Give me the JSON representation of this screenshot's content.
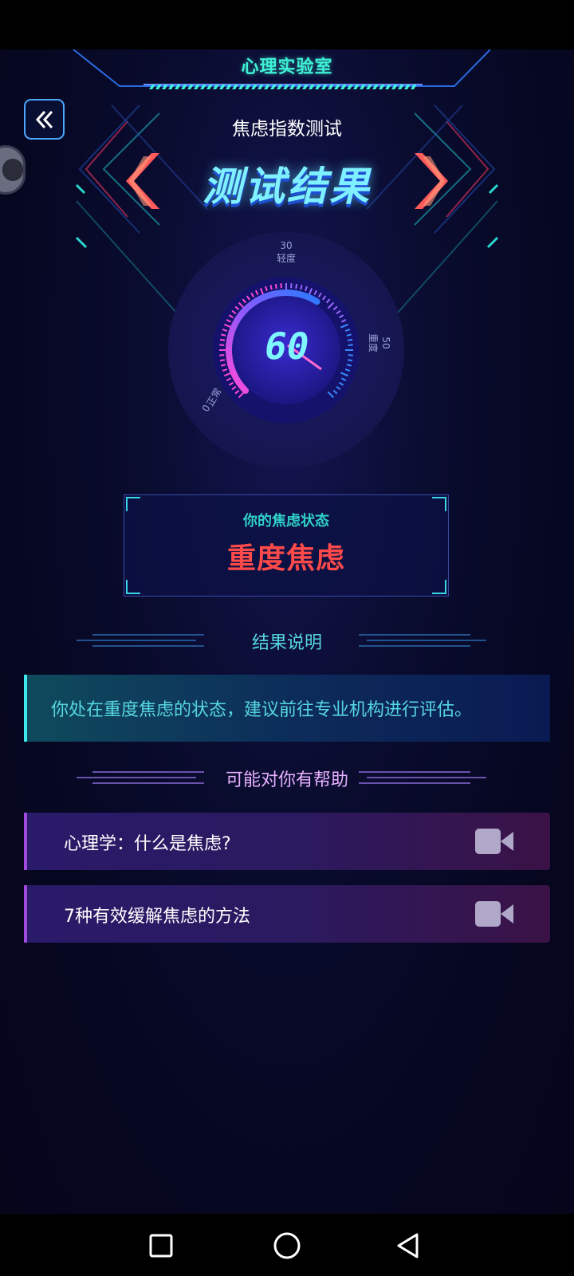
{
  "app": {
    "title": "心理实验室"
  },
  "header": {
    "subtitle": "焦虑指数测试",
    "heading": "测试结果"
  },
  "gauge": {
    "score": "60",
    "score_value": 60,
    "max": 60,
    "labels": [
      {
        "value": "30",
        "text": "轻度"
      },
      {
        "value": "50",
        "text": "重度"
      },
      {
        "value": "0",
        "text": "正常"
      }
    ]
  },
  "status": {
    "label": "你的焦虑状态",
    "value": "重度焦虑"
  },
  "explain": {
    "title": "结果说明",
    "text": "你处在重度焦虑的状态，建议前往专业机构进行评估。"
  },
  "help": {
    "title": "可能对你有帮助",
    "items": [
      {
        "label": "心理学：什么是焦虑?"
      },
      {
        "label": "7种有效缓解焦虑的方法"
      }
    ]
  },
  "colors": {
    "accent_cyan": "#3ff2d6",
    "status_red": "#ff4a4a",
    "arrow_red": "#ff5a5a",
    "help_purple": "#a04ae0"
  },
  "icons": {
    "back": "double-chevron-left-icon",
    "video": "video-camera-icon",
    "nav_recent": "square-icon",
    "nav_home": "circle-icon",
    "nav_back": "triangle-back-icon"
  }
}
